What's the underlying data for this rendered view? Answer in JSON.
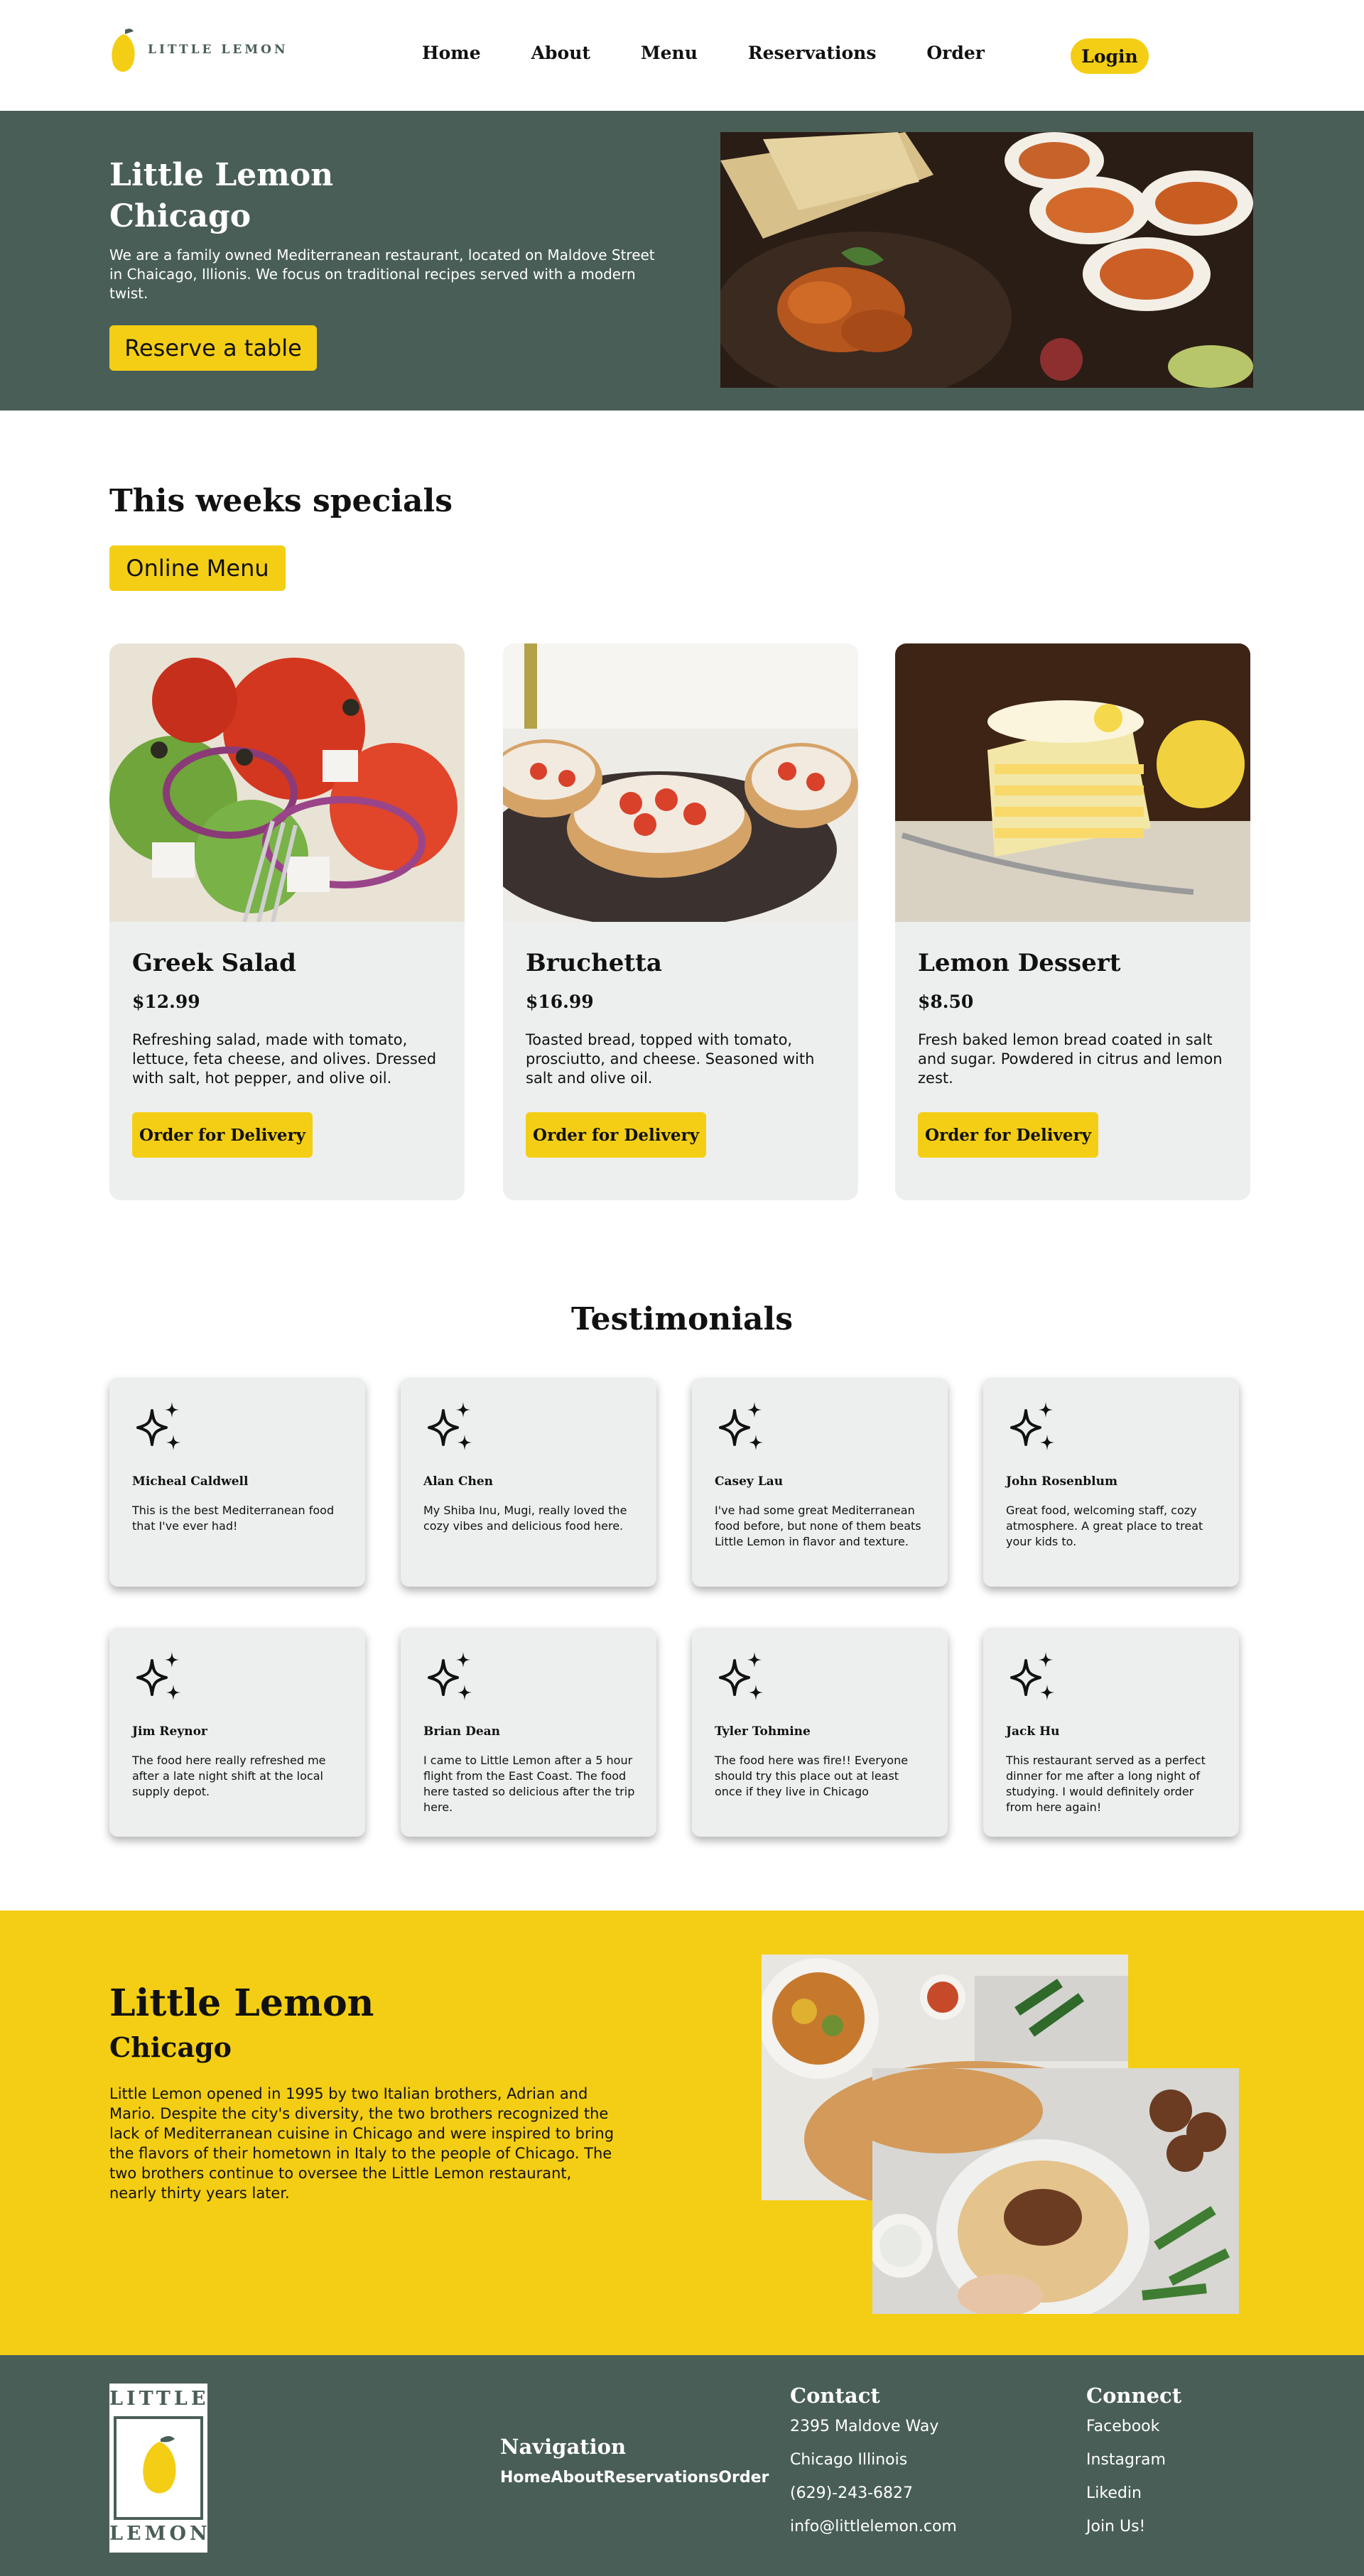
{
  "header": {
    "logo_text": "LITTLE LEMON",
    "nav": [
      "Home",
      "About",
      "Menu",
      "Reservations",
      "Order"
    ],
    "login_label": "Login"
  },
  "hero": {
    "title_line1": "Little Lemon",
    "title_line2": "Chicago",
    "description": "We are a family owned Mediterranean restaurant, located on Maldove Street in Chaicago, Illionis. We focus on traditional recipes served with a modern twist.",
    "button_label": "Reserve a table"
  },
  "specials": {
    "title": "This weeks specials",
    "menu_button_label": "Online Menu",
    "items": [
      {
        "name": "Greek Salad",
        "price": "$12.99",
        "description": "Refreshing salad, made with tomato, lettuce, feta cheese, and olives. Dressed with salt, hot pepper, and olive oil.",
        "button_label": "Order for Delivery"
      },
      {
        "name": "Bruchetta",
        "price": "$16.99",
        "description": "Toasted bread, topped with tomato, prosciutto, and cheese. Seasoned with salt and olive oil.",
        "button_label": "Order for Delivery"
      },
      {
        "name": "Lemon Dessert",
        "price": "$8.50",
        "description": "Fresh baked lemon bread coated in salt and sugar. Powdered in citrus and lemon zest.",
        "button_label": "Order for Delivery"
      }
    ]
  },
  "testimonials": {
    "title": "Testimonials",
    "items": [
      {
        "name": "Micheal Caldwell",
        "text": "This is the best Mediterranean food that I've ever had!"
      },
      {
        "name": "Alan Chen",
        "text": "My Shiba Inu, Mugi, really loved the cozy vibes and delicious food here."
      },
      {
        "name": "Casey Lau",
        "text": "I've had some great Mediterranean food before, but none of them beats Little Lemon in flavor and texture."
      },
      {
        "name": "John Rosenblum",
        "text": "Great food, welcoming staff, cozy atmosphere. A great place to treat your kids to."
      },
      {
        "name": "Jim Reynor",
        "text": "The food here really refreshed me after a late night shift at the local supply depot."
      },
      {
        "name": "Brian Dean",
        "text": "I came to Little Lemon after a 5 hour flight from the East Coast. The food here tasted so delicious after the trip here."
      },
      {
        "name": "Tyler Tohmine",
        "text": "The food here was fire!! Everyone should try this place out at least once if they live in Chicago"
      },
      {
        "name": "Jack Hu",
        "text": "This restaurant served as a perfect dinner for me after a long night of studying. I would definitely order from here again!"
      }
    ]
  },
  "about": {
    "title": "Little Lemon",
    "subtitle": "Chicago",
    "text": "Little Lemon opened in 1995 by two Italian brothers, Adrian and Mario. Despite the city's diversity, the two brothers recognized the lack of Mediterranean cuisine in Chicago and were inspired to bring the flavors of their hometown in Italy to the people of Chicago. The two brothers continue to oversee the Little Lemon restaurant, nearly thirty years later."
  },
  "footer": {
    "logo_top": "LITTLE",
    "logo_bottom": "LEMON",
    "navigation_heading": "Navigation",
    "navigation_links": [
      "Home",
      "About",
      "Reservations",
      "Order"
    ],
    "contact_heading": "Contact",
    "contact_lines": [
      "2395 Maldove Way",
      "Chicago Illinois",
      "(629)-243-6827",
      "info@littlelemon.com"
    ],
    "connect_heading": "Connect",
    "connect_links": [
      "Facebook",
      "Instagram",
      "Likedin",
      "Join Us!"
    ]
  },
  "colors": {
    "primary_green": "#495e57",
    "primary_yellow": "#f4ce14",
    "card_gray": "#edefee"
  }
}
